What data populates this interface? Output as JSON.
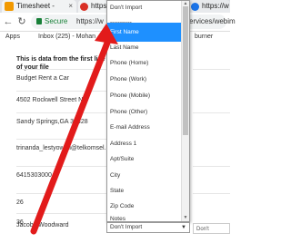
{
  "browser": {
    "tabs": [
      {
        "title": "Timesheet -",
        "close": "×"
      },
      {
        "title": "https://w"
      },
      {
        "title": "https://w"
      }
    ],
    "secure_label": "Secure",
    "url_left": "https://w",
    "url_right": "services/webim",
    "bookmarks": [
      "Apps",
      "Inbox (225) - Mohan",
      "burner"
    ]
  },
  "page": {
    "title": "This is data from the first line of your file",
    "rows": [
      "Budget Rent a Car",
      "4502 Rockwell Street NE",
      "Sandy Springs,GA 30328",
      "trinanda_lestyowati@telkomsel.net",
      "6415303000",
      "26",
      "36",
      "Jacoby Woodward"
    ],
    "right_dropdown_label": "Don't"
  },
  "dropdown": {
    "options": [
      "Don't Import",
      "-----------",
      "First Name",
      "Last Name",
      "Phone (Home)",
      "Phone (Work)",
      "Phone (Mobile)",
      "Phone (Other)",
      "E-mail Address",
      "Address 1",
      "Apt/Suite",
      "City",
      "State",
      "Zip Code",
      "Notes"
    ],
    "selected_option": "First Name",
    "current_value": "Don't Import"
  },
  "colors": {
    "highlight": "#1e90ff",
    "arrow": "#e21b1b"
  }
}
